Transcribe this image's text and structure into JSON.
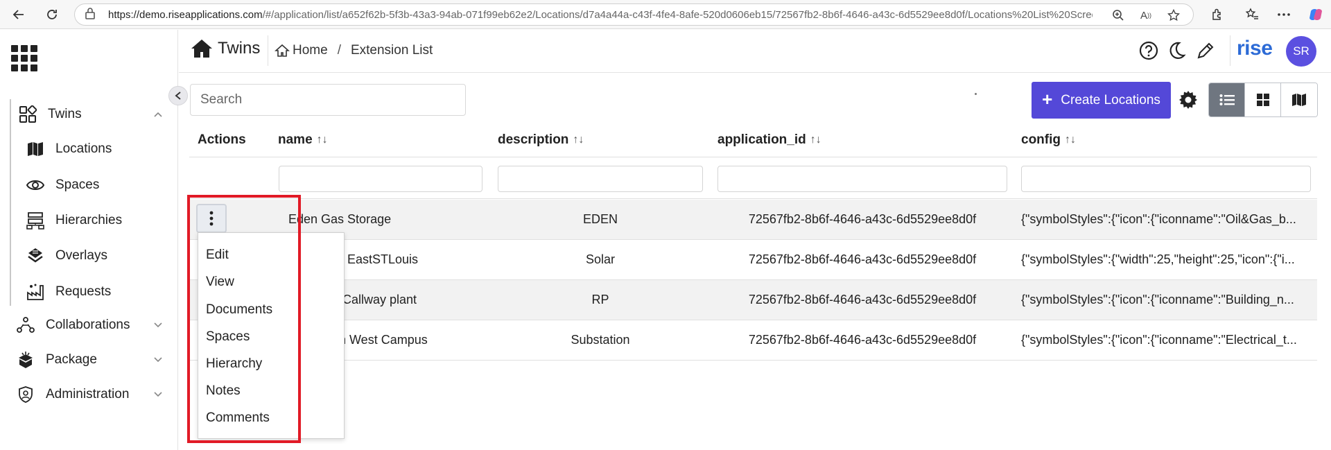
{
  "browser": {
    "url_host": "https://demo.riseapplications.com",
    "url_rest": "/#/application/list/a652f62b-5f3b-43a3-94ab-071f99eb62e2/Locations/d7a4a44a-c43f-4fe4-8afe-520d0606eb15/72567fb2-8b6f-4646-a43c-6d5529ee8d0f/Locations%20List%20Scree..."
  },
  "sidebar": {
    "items": [
      {
        "label": "Twins",
        "icon": "twins-icon",
        "expanded": true
      },
      {
        "label": "Locations",
        "icon": "map-icon"
      },
      {
        "label": "Spaces",
        "icon": "eye-icon"
      },
      {
        "label": "Hierarchies",
        "icon": "hierarchy-icon"
      },
      {
        "label": "Overlays",
        "icon": "overlays-icon"
      },
      {
        "label": "Requests",
        "icon": "requests-icon"
      },
      {
        "label": "Collaborations",
        "icon": "collaborations-icon"
      },
      {
        "label": "Package",
        "icon": "package-icon"
      },
      {
        "label": "Administration",
        "icon": "administration-icon"
      }
    ]
  },
  "header": {
    "app_name": "Twins",
    "breadcrumb": {
      "home": "Home",
      "current": "Extension List"
    },
    "logo": "rise",
    "avatar_initials": "SR"
  },
  "toolbar": {
    "search_placeholder": "Search",
    "create_label": "Create Locations",
    "accent_color": "#5448d8"
  },
  "table": {
    "columns": [
      "Actions",
      "name",
      "description",
      "application_id",
      "config"
    ],
    "rows": [
      {
        "name": "Eden Gas Storage",
        "description": "EDEN",
        "application_id": "72567fb2-8b6f-4646-a43c-6d5529ee8d0f",
        "config": "{\"symbolStyles\":{\"icon\":{\"iconname\":\"Oil&Gas_b..."
      },
      {
        "name": "EastSTLouis",
        "description": "Solar",
        "application_id": "72567fb2-8b6f-4646-a43c-6d5529ee8d0f",
        "config": "{\"symbolStyles\":{\"width\":25,\"height\":25,\"icon\":{\"i..."
      },
      {
        "name": "Callway plant",
        "description": "RP",
        "application_id": "72567fb2-8b6f-4646-a43c-6d5529ee8d0f",
        "config": "{\"symbolStyles\":{\"icon\":{\"iconname\":\"Building_n..."
      },
      {
        "name": "th West Campus",
        "description": "Substation",
        "application_id": "72567fb2-8b6f-4646-a43c-6d5529ee8d0f",
        "config": "{\"symbolStyles\":{\"icon\":{\"iconname\":\"Electrical_t..."
      }
    ]
  },
  "context_menu": {
    "items": [
      "Edit",
      "View",
      "Documents",
      "Spaces",
      "Hierarchy",
      "Notes",
      "Comments"
    ]
  }
}
